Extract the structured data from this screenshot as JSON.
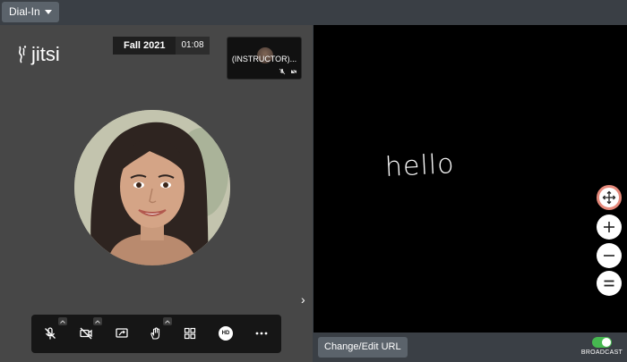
{
  "topbar": {
    "dial_in_label": "Dial-In"
  },
  "jitsi": {
    "logo_text": "jitsi",
    "meeting_title": "Fall 2021",
    "meeting_time": "01:08",
    "thumbnail_name": "(INSTRUCTOR)...",
    "icons": {
      "mic_muted": "mic-off-icon",
      "camera_off": "camera-off-icon",
      "screen_share": "screen-share-icon",
      "raise_hand": "raise-hand-icon",
      "tile_view": "tile-view-icon",
      "hd": "HD",
      "more": "more-icon"
    }
  },
  "whiteboard": {
    "handwriting": "hello"
  },
  "bottombar": {
    "change_url_label": "Change/Edit URL",
    "broadcast_label": "BROADCAST",
    "broadcast_on": true
  },
  "colors": {
    "toggle_on": "#46b850",
    "move_ring": "#e5897b"
  }
}
